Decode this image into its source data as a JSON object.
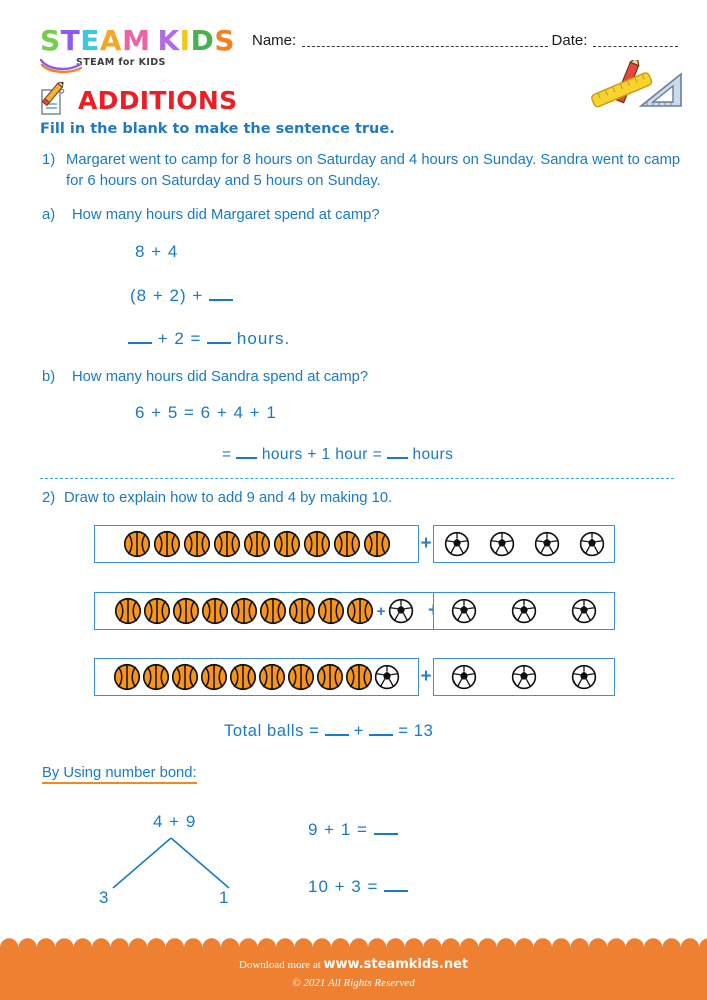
{
  "brand": {
    "logo_letters": [
      {
        "ch": "S",
        "color": "#76cc4b"
      },
      {
        "ch": "T",
        "color": "#8b5cf6"
      },
      {
        "ch": "E",
        "color": "#3ec8e0"
      },
      {
        "ch": "A",
        "color": "#f5a623"
      },
      {
        "ch": "M",
        "color": "#f062a8"
      },
      {
        "ch": "K",
        "color": "#b06ce0"
      },
      {
        "ch": "I",
        "color": "#f5c518"
      },
      {
        "ch": "D",
        "color": "#4caf50"
      },
      {
        "ch": "S",
        "color": "#f58220"
      }
    ],
    "tagline": "STEAM for KIDS"
  },
  "header": {
    "name_label": "Name:",
    "date_label": "Date:",
    "tools_icon": "ruler-pencil-triangle-icon"
  },
  "title": {
    "icon": "pencil-paper-icon",
    "text": "ADDITIONS",
    "color": "#ee1c25"
  },
  "instruction": "Fill in the blank to make the sentence true.",
  "question1": {
    "number": "1)",
    "text": "Margaret went to camp for 8 hours on Saturday and 4 hours on Sunday. Sandra went to camp for 6 hours on Saturday and 5 hours on Sunday.",
    "part_a": {
      "label": "a)",
      "prompt": "How many hours did Margaret spend at camp?",
      "line1": "8  +  4",
      "line2_pre": "(8  +  2)  + ",
      "line3_pre": "",
      "line3_mid": " +  2  = ",
      "line3_post": " hours."
    },
    "part_b": {
      "label": "b)",
      "prompt": "How many hours did Sandra spend at camp?",
      "line1": "6  +  5  =  6  +  4  +  1",
      "line2_a": "=  ",
      "line2_b": " hours + 1 hour  =  ",
      "line2_c": " hours"
    }
  },
  "question2": {
    "number": "2)",
    "text": "Draw to explain how to add 9 and 4 by making 10.",
    "rows": [
      {
        "left_basketballs": 9,
        "left_soccer": 0,
        "left_inner_plus": false,
        "right_soccer": 4
      },
      {
        "left_basketballs": 9,
        "left_soccer": 1,
        "left_inner_plus": true,
        "right_soccer": 3
      },
      {
        "left_basketballs": 9,
        "left_soccer": 1,
        "left_inner_plus": false,
        "right_soccer": 3
      }
    ],
    "row_plus": "+",
    "total_pre": "Total balls  = ",
    "total_mid": "  + ",
    "total_post": "  =  ",
    "total_value": "13"
  },
  "number_bond": {
    "heading": "By Using number bond:",
    "top": "4  +  9",
    "left": "3",
    "right": "1",
    "equation1_pre": "9  +  1  = ",
    "equation2_pre": "10  +  3  = "
  },
  "footer": {
    "line1_pre": "Download more at ",
    "site": "www.steamkids.net",
    "line2": "© 2021 All Rights Reserved",
    "bg_color": "#ed8031"
  },
  "colors": {
    "blue_text": "#1a7ac4",
    "box_border": "#3d8fd4",
    "basketball": "#f7941e",
    "accent_orange": "#ef8a21"
  }
}
